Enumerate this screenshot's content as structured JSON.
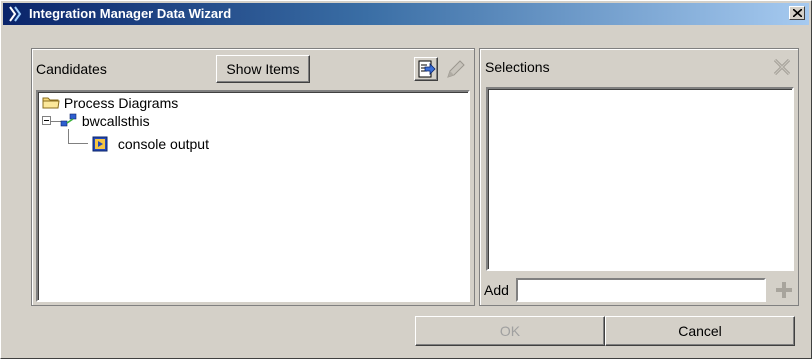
{
  "window": {
    "title": "Integration Manager Data Wizard"
  },
  "candidates": {
    "label": "Candidates",
    "show_items_label": "Show Items",
    "tree": {
      "root": "Process Diagrams",
      "child": "bwcallsthis",
      "leaf": "console output"
    }
  },
  "selections": {
    "label": "Selections",
    "add_label": "Add",
    "add_value": ""
  },
  "footer": {
    "ok_label": "OK",
    "cancel_label": "Cancel"
  },
  "colors": {
    "titlebar_start": "#0a246a",
    "titlebar_end": "#a6caf0",
    "face": "#d4d0c8"
  }
}
